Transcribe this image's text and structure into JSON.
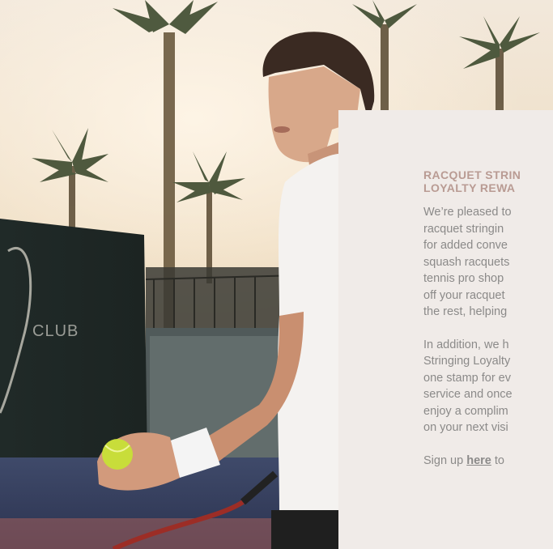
{
  "hero": {
    "image_label": "Tennis player at resort club courts with palm trees"
  },
  "card": {
    "title_lines": [
      "RACQUET STRIN",
      "LOYALTY REWA"
    ],
    "paragraph1_lines": [
      "We’re pleased to",
      "racquet stringin",
      "for added conve",
      "squash racquets",
      "tennis pro shop",
      "off your racquet",
      "the rest, helping"
    ],
    "paragraph2_lines": [
      "In addition, we h",
      "Stringing Loyalty",
      "one stamp for ev",
      "service and once",
      "enjoy a complim",
      "on your next visi"
    ],
    "signup_prefix": "Sign up ",
    "signup_link": "here",
    "signup_suffix": " to"
  },
  "scene_text": {
    "wall_sign": "CLUB"
  }
}
